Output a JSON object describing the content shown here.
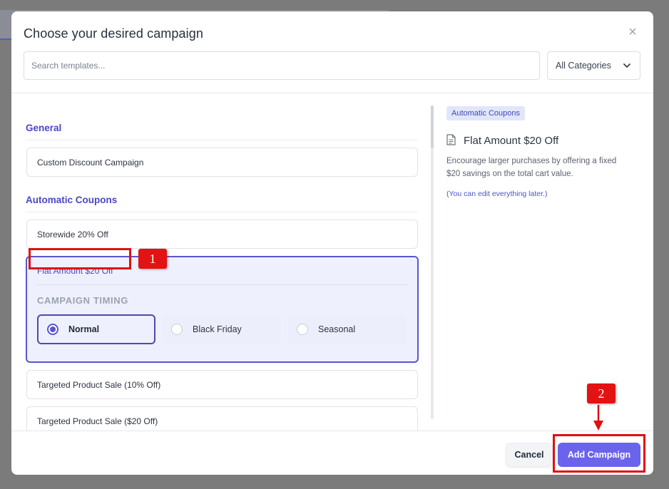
{
  "modal": {
    "title": "Choose your desired campaign",
    "close_glyph": "×",
    "search_placeholder": "Search templates...",
    "category_select": {
      "selected": "All Categories"
    }
  },
  "sections": [
    {
      "heading": "General",
      "items": [
        "Custom Discount Campaign"
      ]
    },
    {
      "heading": "Automatic Coupons",
      "items": [
        "Storewide 20% Off",
        "Flat Amount $20 Off",
        "Targeted Product Sale (10% Off)",
        "Targeted Product Sale ($20 Off)"
      ]
    }
  ],
  "selected_item": {
    "title": "Flat Amount $20 Off",
    "timing_label": "CAMPAIGN TIMING",
    "options": [
      "Normal",
      "Black Friday",
      "Seasonal"
    ],
    "selected_option": "Normal"
  },
  "preview": {
    "tag": "Automatic Coupons",
    "title": "Flat Amount $20 Off",
    "description": "Encourage larger purchases by offering a fixed $20 savings on the total cart value.",
    "note": "(You can edit everything later.)"
  },
  "footer": {
    "cancel_label": "Cancel",
    "add_label": "Add Campaign"
  },
  "annotations": {
    "badge_1": "1",
    "badge_2": "2"
  },
  "colors": {
    "accent": "#5b55cc",
    "primary_button": "#6b63ec",
    "annotation": "#e31313"
  },
  "icons": {
    "close": "close-icon",
    "select": "chevron-down-icon",
    "preview": "document-icon"
  }
}
